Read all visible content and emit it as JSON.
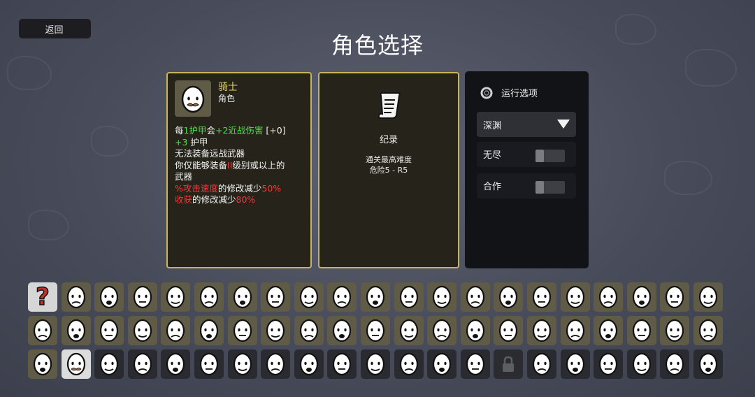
{
  "nav": {
    "back_label": "返回"
  },
  "title": "角色选择",
  "character": {
    "name": "骑士",
    "type": "角色",
    "desc": {
      "l1_a": "每",
      "l1_b": "1护甲",
      "l1_c": "会",
      "l1_d": "+2近战伤害",
      "l1_e": " [+0]",
      "l2_a": "+3",
      "l2_b": " 护甲",
      "l3": "无法装备远战武器",
      "l4_a": "你仅能够装备",
      "l4_b": "II",
      "l4_c": "级别或以上的",
      "l5": "武器",
      "l6_a": "%攻击速度",
      "l6_b": "的修改减少",
      "l6_c": "50%",
      "l7_a": "收获",
      "l7_b": "的修改减少",
      "l7_c": "80%"
    }
  },
  "record": {
    "icon": "scroll-icon",
    "title": "纪录",
    "subtitle": "通关最高难度",
    "value": "危险5 - R5"
  },
  "run_options": {
    "icon": "ring-icon",
    "title": "运行选项",
    "difficulty": "深渊",
    "endless_label": "无尽",
    "endless_on": false,
    "coop_label": "合作",
    "coop_on": false
  },
  "colors": {
    "accent_gold": "#c8b45a",
    "positive_green": "#4fe04f",
    "negative_red": "#f03a3a"
  },
  "grid": {
    "columns": 21,
    "rows": 3,
    "selected": {
      "row": 2,
      "col": 1
    },
    "locked": [
      {
        "row": 2,
        "col": 14
      }
    ],
    "unknown_label": "?",
    "locked_icon": "padlock-icon"
  }
}
